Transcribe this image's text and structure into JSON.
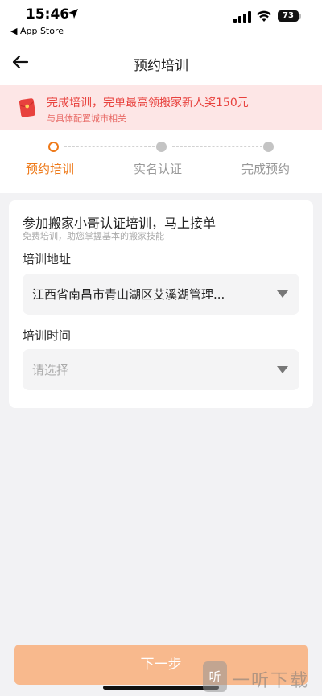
{
  "status_bar": {
    "time": "15:46",
    "back_app": "◀ App Store",
    "battery": "73"
  },
  "nav": {
    "title": "预约培训"
  },
  "banner": {
    "main_text": "完成培训，完单最高领搬家新人奖150元",
    "sub_text": "与具体配置城市相关"
  },
  "steps": [
    {
      "label": "预约培训",
      "active": true
    },
    {
      "label": "实名认证",
      "active": false
    },
    {
      "label": "完成预约",
      "active": false
    }
  ],
  "card": {
    "title": "参加搬家小哥认证培训，马上接单",
    "subtitle": "免费培训，助您掌握基本的搬家技能",
    "address_label": "培训地址",
    "address_value": "江西省南昌市青山湖区艾溪湖管理...",
    "time_label": "培训时间",
    "time_placeholder": "请选择"
  },
  "footer": {
    "next_label": "下一步"
  },
  "watermark": {
    "badge": "听",
    "text": "一听下载"
  },
  "colors": {
    "accent": "#ee7a1a",
    "banner_bg": "#fde6e6",
    "banner_text": "#e8413d",
    "button_bg": "#f8b98d"
  }
}
